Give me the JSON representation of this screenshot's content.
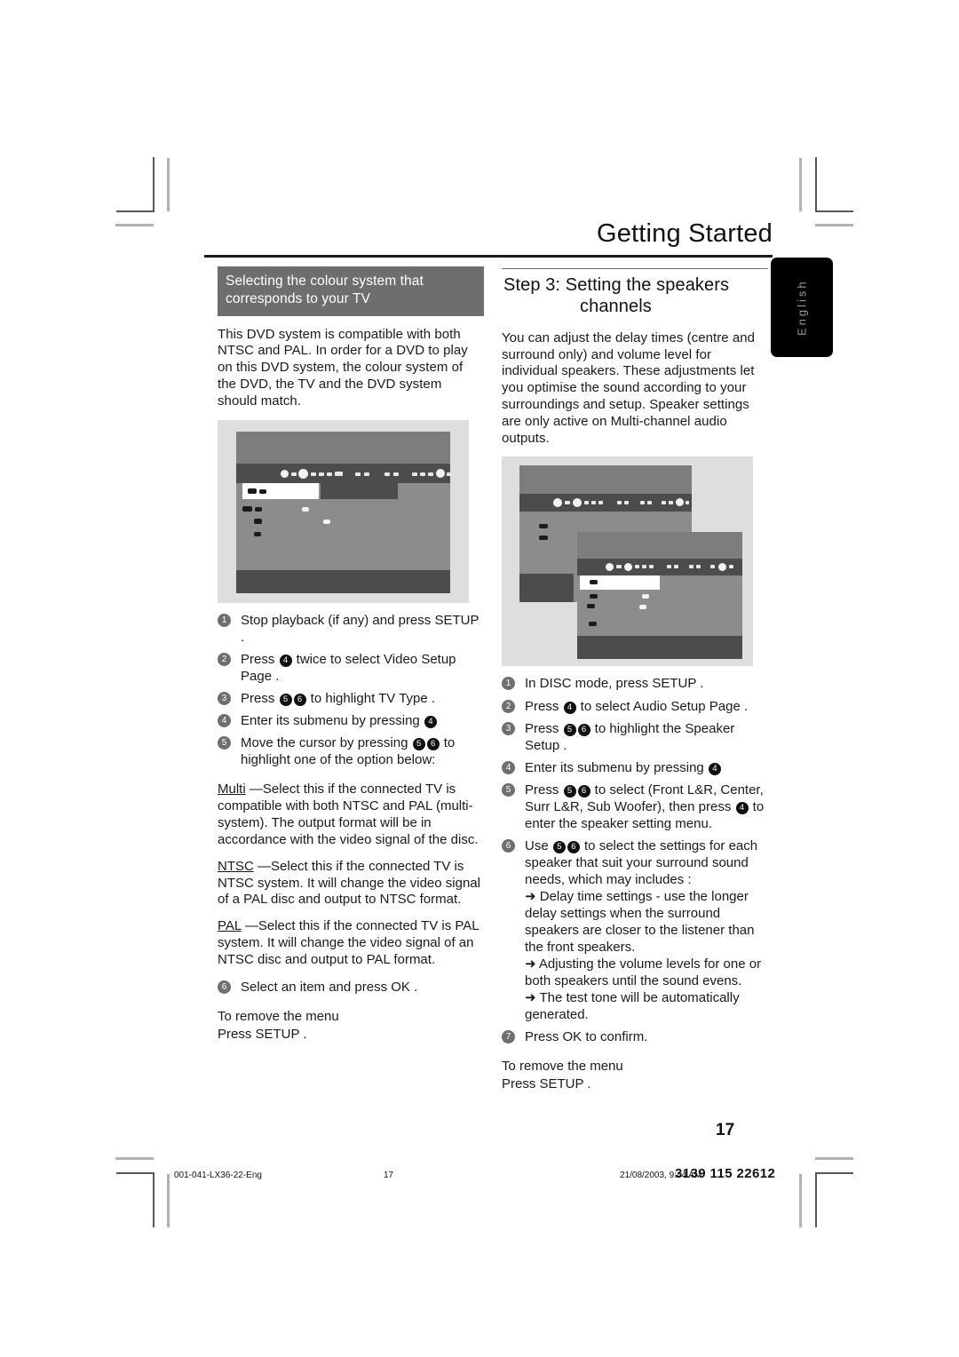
{
  "header": {
    "title": "Getting Started",
    "side_tab": "English"
  },
  "left_column": {
    "banner": "Selecting the colour system that corresponds to your TV",
    "intro": "This DVD system is compatible with both NTSC and PAL.  In order for a DVD to play on this DVD system, the colour system of the DVD, the TV and the DVD system should match.",
    "screenshot_name": "video-setup-page-osd",
    "steps": [
      {
        "num": "1",
        "text_before": "Stop playback (if any) and press SETUP .",
        "keys": []
      },
      {
        "num": "2",
        "text_before": "Press ",
        "key1": "4",
        "text_mid": " twice to select  Video Setup Page ."
      },
      {
        "num": "3",
        "text_before": "Press ",
        "key1": "5",
        "key2": "6",
        "text_mid": " to highlight  TV Type ."
      },
      {
        "num": "4",
        "text_before": "Enter its submenu by pressing ",
        "key1": "4",
        "text_mid": ""
      },
      {
        "num": "5",
        "text_before": "Move the cursor by pressing ",
        "key1": "5",
        "key2": "6",
        "text_mid": " to highlight one of the option below:"
      },
      {
        "num": "6",
        "text_before": "Select an item and press OK .",
        "keys": []
      }
    ],
    "options": [
      {
        "term": "Multi",
        "desc": "—Select this if the connected TV is compatible with both NTSC and PAL (multi-system).  The output format will be in accordance with the video signal of the disc."
      },
      {
        "term": "NTSC",
        "desc": "—Select this if the connected TV is NTSC system. It will change the video signal of a PAL disc and output to NTSC format."
      },
      {
        "term": "PAL",
        "desc": "—Select this if the connected TV is PAL system. It will change the video signal of an NTSC disc and output to PAL format."
      }
    ],
    "remove_line1": "To remove the menu",
    "remove_line2": "Press SETUP ."
  },
  "right_column": {
    "step_label": "Step 3:",
    "step_title_line1": "Setting the speakers",
    "step_title_line2": "channels",
    "intro": "You can adjust the delay times (centre and surround only) and volume level for individual speakers. These adjustments let you optimise the sound according to your surroundings and setup.  Speaker settings are only active on Multi-channel audio outputs.",
    "screenshot_name": "audio-setup-speaker-setup-osd",
    "steps": [
      {
        "num": "1",
        "text_before": "In DISC mode, press SETUP ."
      },
      {
        "num": "2",
        "text_before": "Press ",
        "key1": "4",
        "text_mid": " to select  Audio Setup Page ."
      },
      {
        "num": "3",
        "text_before": "Press ",
        "key1": "5",
        "key2": "6",
        "text_mid": " to highlight the  Speaker Setup ."
      },
      {
        "num": "4",
        "text_before": "Enter its submenu by pressing ",
        "key1": "4",
        "text_mid": ""
      },
      {
        "num": "5",
        "text_before": "Press ",
        "key1": "5",
        "key2": "6",
        "text_mid": " to select (Front L&R, Center, Surr L&R, Sub Woofer), then press ",
        "key3": "4",
        "text_after": " to enter the speaker setting menu."
      },
      {
        "num": "6",
        "text_before": "Use ",
        "key1": "5",
        "key2": "6",
        "text_mid": " to select the settings for each speaker that suit your surround sound needs, which may includes :"
      },
      {
        "num": "7",
        "text_before": "Press OK  to confirm."
      }
    ],
    "sub_bullets": [
      "Delay time settings - use the longer delay settings when the surround speakers are closer to the listener than the front speakers.",
      "Adjusting the volume levels for one or both speakers until the sound evens.",
      "The test tone will be automatically generated."
    ],
    "remove_line1": "To remove the menu",
    "remove_line2": "Press SETUP ."
  },
  "footer": {
    "page_number": "17",
    "file_name": "001-041-LX36-22-Eng",
    "file_page": "17",
    "date": "21/08/2003, 9:44 AM",
    "code": "3139 115 22612"
  },
  "colors": {
    "banner_gray": "#6e6e6e",
    "rule_black": "#1b1b1b",
    "tab_black": "#000000",
    "tab_text": "#9a9a9a",
    "screenshot_bg": "#dededf",
    "osd_body": "#8c8c8c",
    "osd_bar": "#4c4c4c"
  }
}
